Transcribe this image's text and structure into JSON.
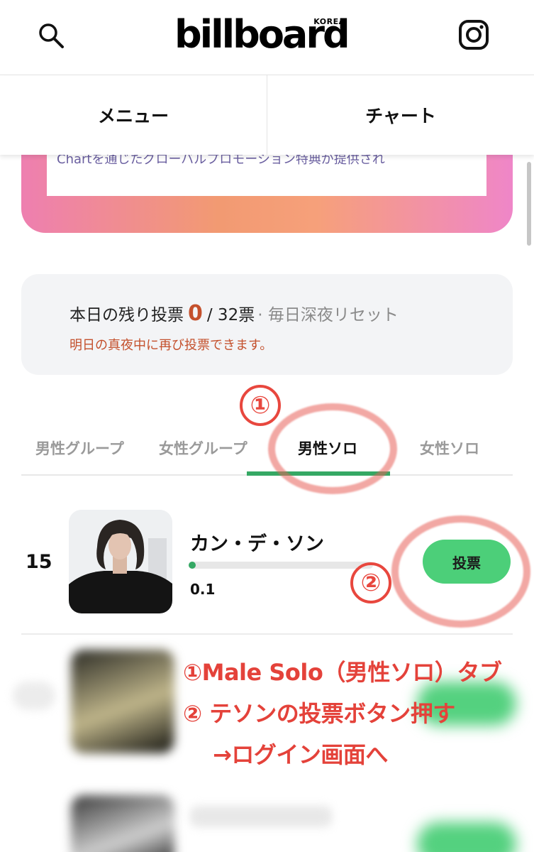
{
  "header": {
    "logo_main": "billboard",
    "logo_sub": "KOREA",
    "search_icon": "search-icon",
    "instagram_icon": "instagram-icon"
  },
  "nav": {
    "menu_label": "メニュー",
    "chart_label": "チャート"
  },
  "banner": {
    "partial_text": "Chartを通じたグローバルプロモーション特典が提供され"
  },
  "vote_info": {
    "remaining_label": "本日の残り投票",
    "remaining_count": "0",
    "total": "/ 32票",
    "reset_note": "· 毎日深夜リセット",
    "notice": "明日の真夜中に再び投票できます。"
  },
  "tabs": [
    {
      "label": "男性グループ",
      "active": false
    },
    {
      "label": "女性グループ",
      "active": false
    },
    {
      "label": "男性ソロ",
      "active": true
    },
    {
      "label": "女性ソロ",
      "active": false
    }
  ],
  "entry": {
    "rank": "15",
    "name": "カン・デ・ソン",
    "score": "0.1",
    "progress_fraction": 0.01,
    "vote_button": "投票"
  },
  "annotations": {
    "marker1": "①",
    "marker2": "②",
    "line1": "①Male Solo（男性ソロ）タブ",
    "line2": "② テソンの投票ボタン押す",
    "line3": "→ログイン画面へ"
  },
  "colors": {
    "accent_green": "#35a864",
    "vote_button": "#4ccf79",
    "alert_red": "#c4502c",
    "annotation_red": "#e4423a"
  }
}
